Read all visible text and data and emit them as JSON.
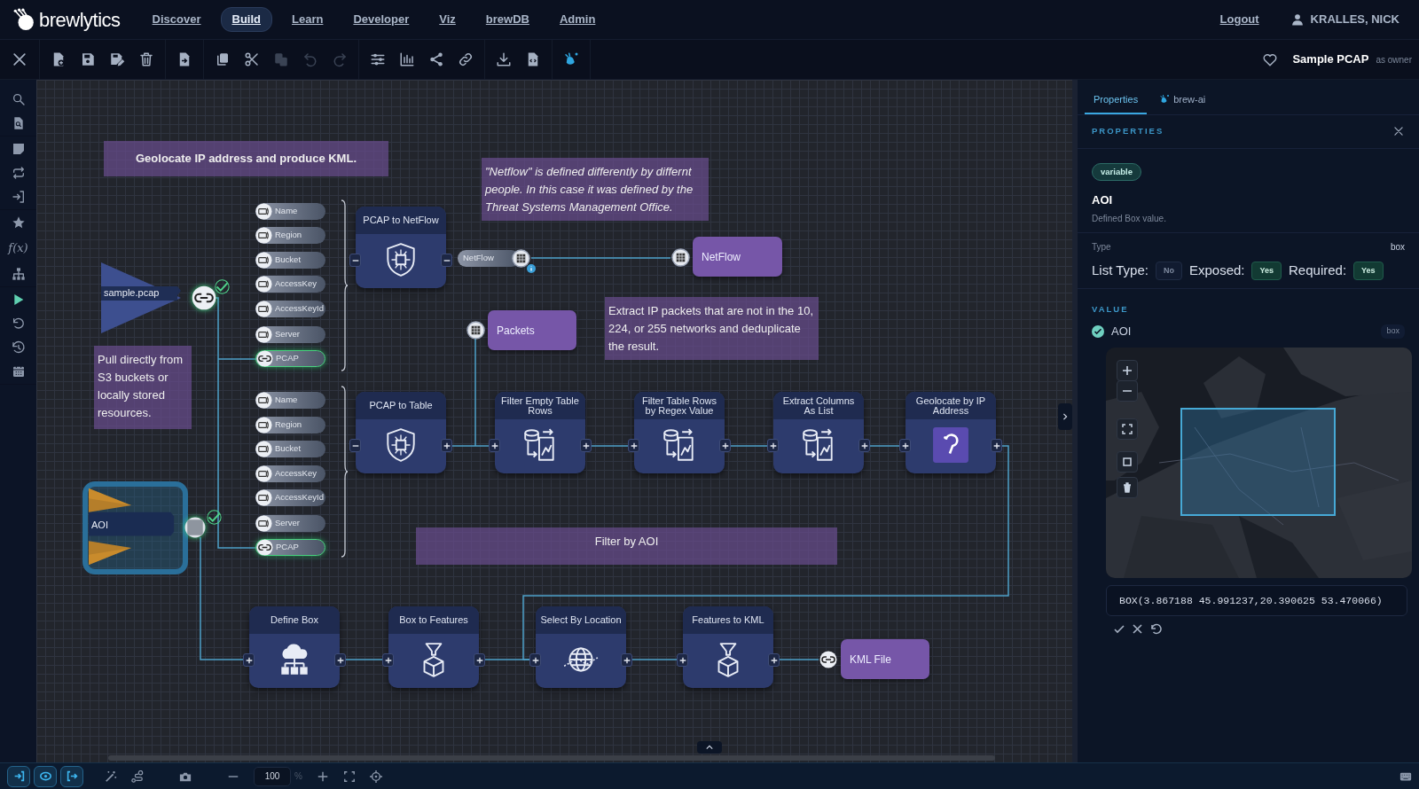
{
  "nav": {
    "logo": "brewlytics",
    "items": [
      {
        "label": "Discover",
        "selected": false
      },
      {
        "label": "Build",
        "selected": true
      },
      {
        "label": "Learn",
        "selected": false
      },
      {
        "label": "Developer",
        "selected": false
      },
      {
        "label": "Viz",
        "selected": false
      },
      {
        "label": "brewDB",
        "selected": false
      },
      {
        "label": "Admin",
        "selected": false
      }
    ],
    "logout": "Logout",
    "user": "KRALLES, NICK"
  },
  "toolbar": {
    "groups": [
      [
        {
          "kind": "close",
          "disabled": false
        }
      ],
      [
        {
          "kind": "new",
          "disabled": false
        },
        {
          "kind": "save",
          "disabled": false
        },
        {
          "kind": "saveas",
          "disabled": false
        },
        {
          "kind": "delete",
          "disabled": false
        }
      ],
      [
        {
          "kind": "export",
          "disabled": false
        }
      ],
      [
        {
          "kind": "copy",
          "disabled": false
        },
        {
          "kind": "cut",
          "disabled": false
        },
        {
          "kind": "paste",
          "disabled": true
        },
        {
          "kind": "undo",
          "disabled": true
        },
        {
          "kind": "redo",
          "disabled": true
        }
      ],
      [
        {
          "kind": "sliders",
          "disabled": false
        },
        {
          "kind": "chart",
          "disabled": false
        },
        {
          "kind": "share",
          "disabled": false
        },
        {
          "kind": "link",
          "disabled": false
        }
      ],
      [
        {
          "kind": "download",
          "disabled": false
        },
        {
          "kind": "code",
          "disabled": false
        }
      ],
      [
        {
          "kind": "ai",
          "disabled": false
        }
      ]
    ],
    "favorite": false,
    "title": "Sample PCAP",
    "role": "as owner"
  },
  "rail": {
    "function_label": "f(x)"
  },
  "canvas": {
    "notes": [
      {
        "kind": "title",
        "text": "Geolocate IP address and produce KML."
      },
      {
        "kind": "italic",
        "text": "\"Netflow\" is defined differently by differnt people. In this case it was defined by the Threat Systems Management Office."
      },
      {
        "kind": "plain",
        "text": "Pull directly from S3 buckets or locally stored resources."
      },
      {
        "kind": "plain",
        "text": "Extract IP packets that are not in the 10, 224, or 255 networks and deduplicate the result."
      },
      {
        "kind": "plain",
        "text": "Filter by AOI"
      }
    ],
    "inputs": [
      {
        "label": "sample.pcap",
        "kind": "link",
        "selected": false,
        "valid": true
      },
      {
        "label": "AOI",
        "kind": "box",
        "selected": true,
        "valid": true
      }
    ],
    "pill_groups": [
      [
        {
          "label": "Name",
          "connected": false
        },
        {
          "label": "Region",
          "connected": false
        },
        {
          "label": "Bucket",
          "connected": false
        },
        {
          "label": "AccessKey",
          "connected": false
        },
        {
          "label": "AccessKeyId",
          "connected": false
        },
        {
          "label": "Server",
          "connected": false
        },
        {
          "label": "PCAP",
          "connected": true
        }
      ],
      [
        {
          "label": "Name",
          "connected": false
        },
        {
          "label": "Region",
          "connected": false
        },
        {
          "label": "Bucket",
          "connected": false
        },
        {
          "label": "AccessKey",
          "connected": false
        },
        {
          "label": "AccessKeyId",
          "connected": false
        },
        {
          "label": "Server",
          "connected": false
        },
        {
          "label": "PCAP",
          "connected": true
        }
      ]
    ],
    "processes": [
      {
        "title": "PCAP to NetFlow",
        "inputs_expanded": true,
        "outputs_expanded": true
      },
      {
        "title": "PCAP to Table",
        "inputs_expanded": true,
        "outputs_expanded": false
      },
      {
        "title": "Filter Empty Table Rows",
        "inputs_expanded": false,
        "outputs_expanded": false
      },
      {
        "title": "Filter Table Rows by Regex Value",
        "inputs_expanded": false,
        "outputs_expanded": false
      },
      {
        "title": "Extract Columns As List",
        "inputs_expanded": false,
        "outputs_expanded": false
      },
      {
        "title": "Geolocate by IP Address",
        "inputs_expanded": false,
        "outputs_expanded": false
      },
      {
        "title": "Define Box",
        "inputs_expanded": false,
        "outputs_expanded": false
      },
      {
        "title": "Box to Features",
        "inputs_expanded": false,
        "outputs_expanded": false
      },
      {
        "title": "Select By Location",
        "inputs_expanded": false,
        "outputs_expanded": false
      },
      {
        "title": "Features to KML",
        "inputs_expanded": false,
        "outputs_expanded": false
      }
    ],
    "port_pill": "NetFlow",
    "outputs": [
      {
        "label": "NetFlow",
        "kind": "table"
      },
      {
        "label": "Packets",
        "kind": "table"
      },
      {
        "label": "KML File",
        "kind": "link"
      }
    ]
  },
  "panel": {
    "tabs": [
      {
        "label": "Properties",
        "selected": true
      },
      {
        "label": "brew-ai",
        "selected": false
      }
    ],
    "heading": "PROPERTIES",
    "badge": "variable",
    "name": "AOI",
    "description": "Defined Box value.",
    "type_label": "Type",
    "type_value": "box",
    "flags": [
      {
        "label": "List Type:",
        "value": "No",
        "on": false
      },
      {
        "label": "Exposed:",
        "value": "Yes",
        "on": true
      },
      {
        "label": "Required:",
        "value": "Yes",
        "on": true
      }
    ],
    "value_heading": "VALUE",
    "value": {
      "name": "AOI",
      "valid": true,
      "type": "box",
      "wkt": "BOX(3.867188 45.991237,20.390625 53.470066)"
    }
  },
  "bottom": {
    "zoom": "100",
    "unit": "%"
  }
}
